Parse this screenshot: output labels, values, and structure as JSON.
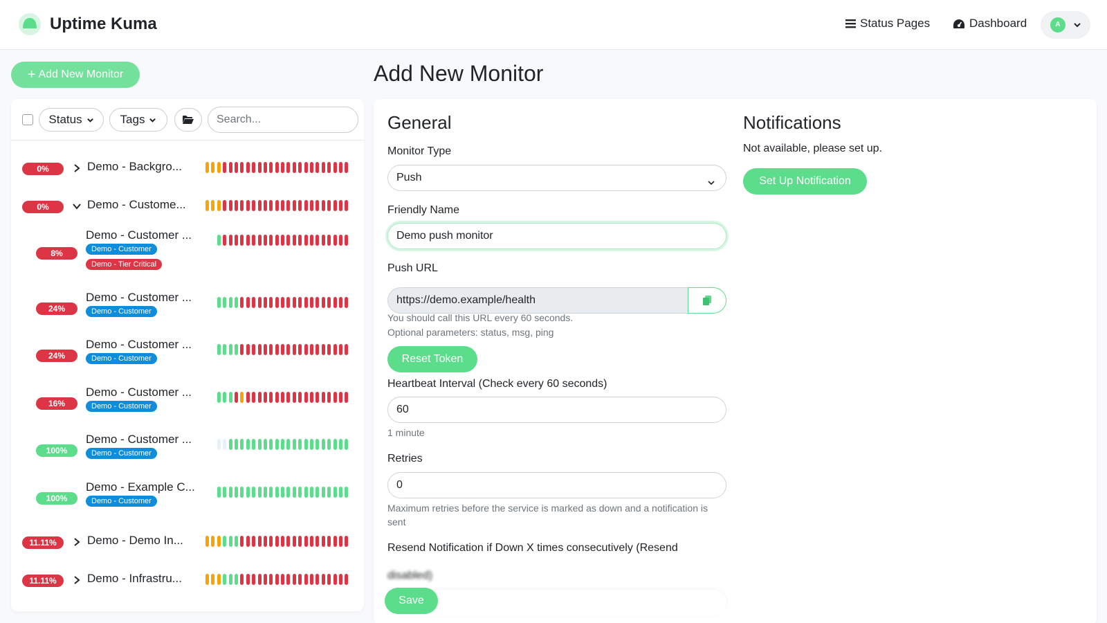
{
  "app": {
    "title": "Uptime Kuma",
    "logo_icon": "uptime-kuma-logo"
  },
  "nav": {
    "status_pages": "Status Pages",
    "dashboard": "Dashboard",
    "avatar_initial": "A"
  },
  "sidebar": {
    "add_button": "Add New Monitor",
    "filters": {
      "status": "Status",
      "tags": "Tags",
      "search_placeholder": "Search..."
    },
    "monitors": [
      {
        "name": "Demo - Backgro...",
        "percent": "0%",
        "status": "down",
        "chevron": "right",
        "tags": [],
        "beats": "pppdddddddddddddddddddddd"
      },
      {
        "name": "Demo - Custome...",
        "percent": "0%",
        "status": "down",
        "chevron": "down",
        "tags": [],
        "beats": "pppdddddddddddddddddddddd"
      },
      {
        "name": "Demo - Customer ...",
        "percent": "8%",
        "status": "down",
        "child": true,
        "tags": [
          {
            "label": "Demo - Customer",
            "color": "#0d8ddb"
          },
          {
            "label": "Demo - Tier Critical",
            "color": "#dc3545"
          }
        ],
        "beats": "udddddddddddddddddddddd"
      },
      {
        "name": "Demo - Customer ...",
        "percent": "24%",
        "status": "down",
        "child": true,
        "tags": [
          {
            "label": "Demo - Customer",
            "color": "#0d8ddb"
          }
        ],
        "beats": "uuuuddddddddddddddddddd"
      },
      {
        "name": "Demo - Customer ...",
        "percent": "24%",
        "status": "down",
        "child": true,
        "tags": [
          {
            "label": "Demo - Customer",
            "color": "#0d8ddb"
          }
        ],
        "beats": "uuuuddddddddddddddddddd"
      },
      {
        "name": "Demo - Customer ...",
        "percent": "16%",
        "status": "down",
        "child": true,
        "tags": [
          {
            "label": "Demo - Customer",
            "color": "#0d8ddb"
          }
        ],
        "beats": "uuudpdddddddddddddddddd"
      },
      {
        "name": "Demo - Customer ...",
        "percent": "100%",
        "status": "up",
        "child": true,
        "tags": [
          {
            "label": "Demo - Customer",
            "color": "#0d8ddb"
          }
        ],
        "beats": "eeuuuuuuuuuuuuuuuuuuuuu"
      },
      {
        "name": "Demo - Example C...",
        "percent": "100%",
        "status": "up",
        "child": true,
        "tags": [
          {
            "label": "Demo - Customer",
            "color": "#0d8ddb"
          }
        ],
        "beats": "uuuuuuuuuuuuuuuuuuuuuuu"
      },
      {
        "name": "Demo - Demo In...",
        "percent": "11.11%",
        "status": "down",
        "chevron": "right",
        "tags": [],
        "beats": "pppuuuddddddddddddddddddd"
      },
      {
        "name": "Demo - Infrastru...",
        "percent": "11.11%",
        "status": "down",
        "chevron": "right",
        "tags": [],
        "beats": "pppuuuddddddddddddddddddd"
      }
    ]
  },
  "form": {
    "page_title": "Add New Monitor",
    "general_heading": "General",
    "monitor_type_label": "Monitor Type",
    "monitor_type_value": "Push",
    "friendly_name_label": "Friendly Name",
    "friendly_name_value": "Demo push monitor",
    "push_url_label": "Push URL",
    "push_url_value": "https://demo.example/health",
    "push_help_1": "You should call this URL every 60 seconds.",
    "push_help_2": "Optional parameters: status, msg, ping",
    "reset_token": "Reset Token",
    "interval_label": "Heartbeat Interval (Check every 60 seconds)",
    "interval_value": "60",
    "interval_help": "1 minute",
    "retries_label": "Retries",
    "retries_value": "0",
    "retries_help": "Maximum retries before the service is marked as down and a notification is sent",
    "resend_label": "Resend Notification if Down X times consecutively (Resend",
    "resend_label_cont": "disabled)",
    "save": "Save"
  },
  "notifications": {
    "heading": "Notifications",
    "text": "Not available, please set up.",
    "setup_button": "Set Up Notification"
  },
  "colors": {
    "accent": "#5cdd8b",
    "down": "#dc3545",
    "pending": "#f8a306",
    "tag_blue": "#0d8ddb"
  }
}
